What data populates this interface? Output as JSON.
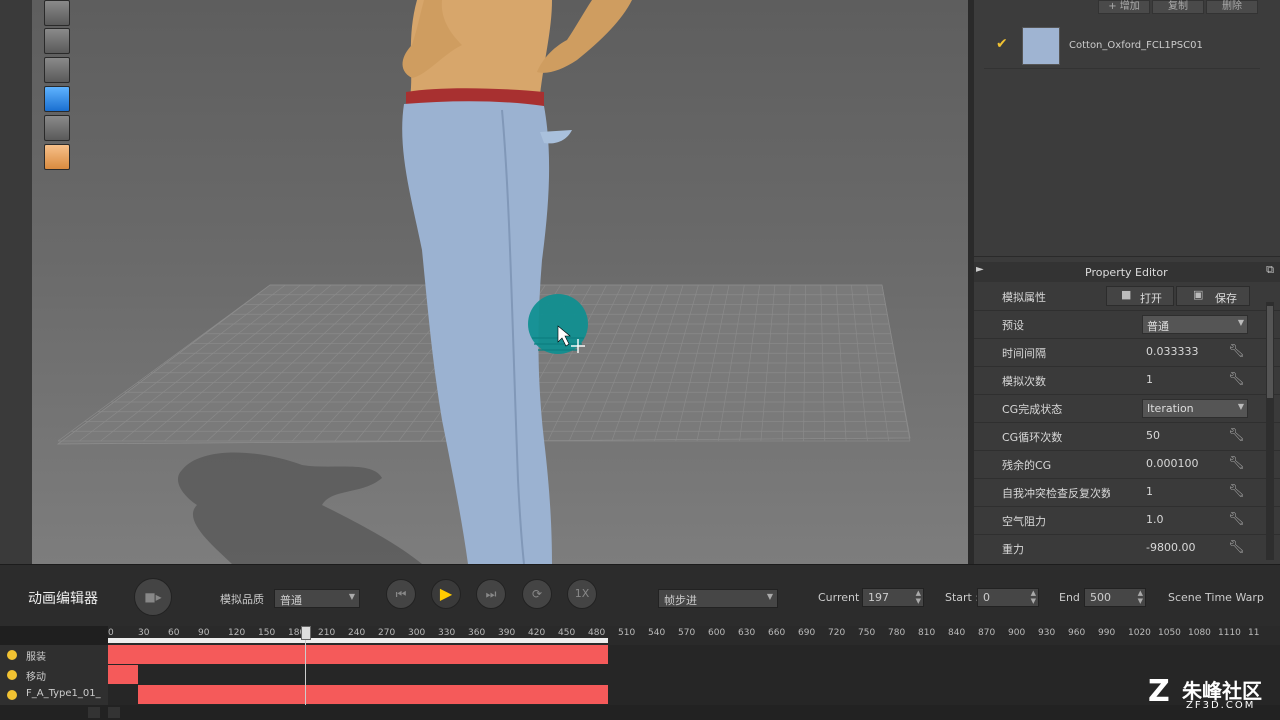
{
  "viewport": {
    "tools": [
      "shirt-icon",
      "shirt-icon",
      "avatar-icon",
      "cube-icon",
      "cloth-icon",
      "avatar-face-icon"
    ]
  },
  "library": {
    "add_label": "+ 增加",
    "copy_label": "复制",
    "delete_label": "删除",
    "fabric_name": "Cotton_Oxford_FCL1PSC01",
    "fabric_color": "#9fb4d2"
  },
  "property_editor": {
    "title": "Property Editor",
    "section": "模拟属性",
    "open_label": "打开",
    "save_label": "保存",
    "rows": [
      {
        "label": "预设",
        "value": "普通",
        "kind": "select"
      },
      {
        "label": "时间间隔",
        "value": "0.033333",
        "kind": "text"
      },
      {
        "label": "模拟次数",
        "value": "1",
        "kind": "text"
      },
      {
        "label": "CG完成状态",
        "value": "Iteration",
        "kind": "select"
      },
      {
        "label": "CG循环次数",
        "value": "50",
        "kind": "text"
      },
      {
        "label": "残余的CG",
        "value": "0.000100",
        "kind": "text"
      },
      {
        "label": "自我冲突检查反复次数",
        "value": "1",
        "kind": "text"
      },
      {
        "label": "空气阻力",
        "value": "1.0",
        "kind": "text"
      },
      {
        "label": "重力",
        "value": "-9800.00",
        "kind": "text"
      }
    ]
  },
  "animation": {
    "title": "动画编辑器",
    "quality_label": "模拟品质",
    "quality_value": "普通",
    "speed_label": "1X",
    "step_mode": "帧步进",
    "current_label": "Current :",
    "current_value": "197",
    "start_label": "Start :",
    "start_value": "0",
    "end_label": "End :",
    "end_value": "500",
    "time_warp": "Scene Time Warp"
  },
  "timeline": {
    "ticks": [
      "0",
      "30",
      "60",
      "90",
      "120",
      "150",
      "180",
      "210",
      "240",
      "270",
      "300",
      "330",
      "360",
      "390",
      "420",
      "450",
      "480",
      "510",
      "540",
      "570",
      "600",
      "630",
      "660",
      "690",
      "720",
      "750",
      "780",
      "810",
      "840",
      "870",
      "900",
      "930",
      "960",
      "990",
      "1020",
      "1050",
      "1080",
      "1110",
      "11"
    ],
    "tracks": [
      {
        "label": "服装",
        "clip_start": 0,
        "clip_end": 500
      },
      {
        "label": "移动",
        "clip_start": 0,
        "clip_end": 30
      },
      {
        "label": "F_A_Type1_01_",
        "clip_start": 30,
        "clip_end": 500
      }
    ],
    "playhead": 197
  },
  "watermark": {
    "brand": "朱峰社区",
    "url": "ZF3D.COM"
  }
}
